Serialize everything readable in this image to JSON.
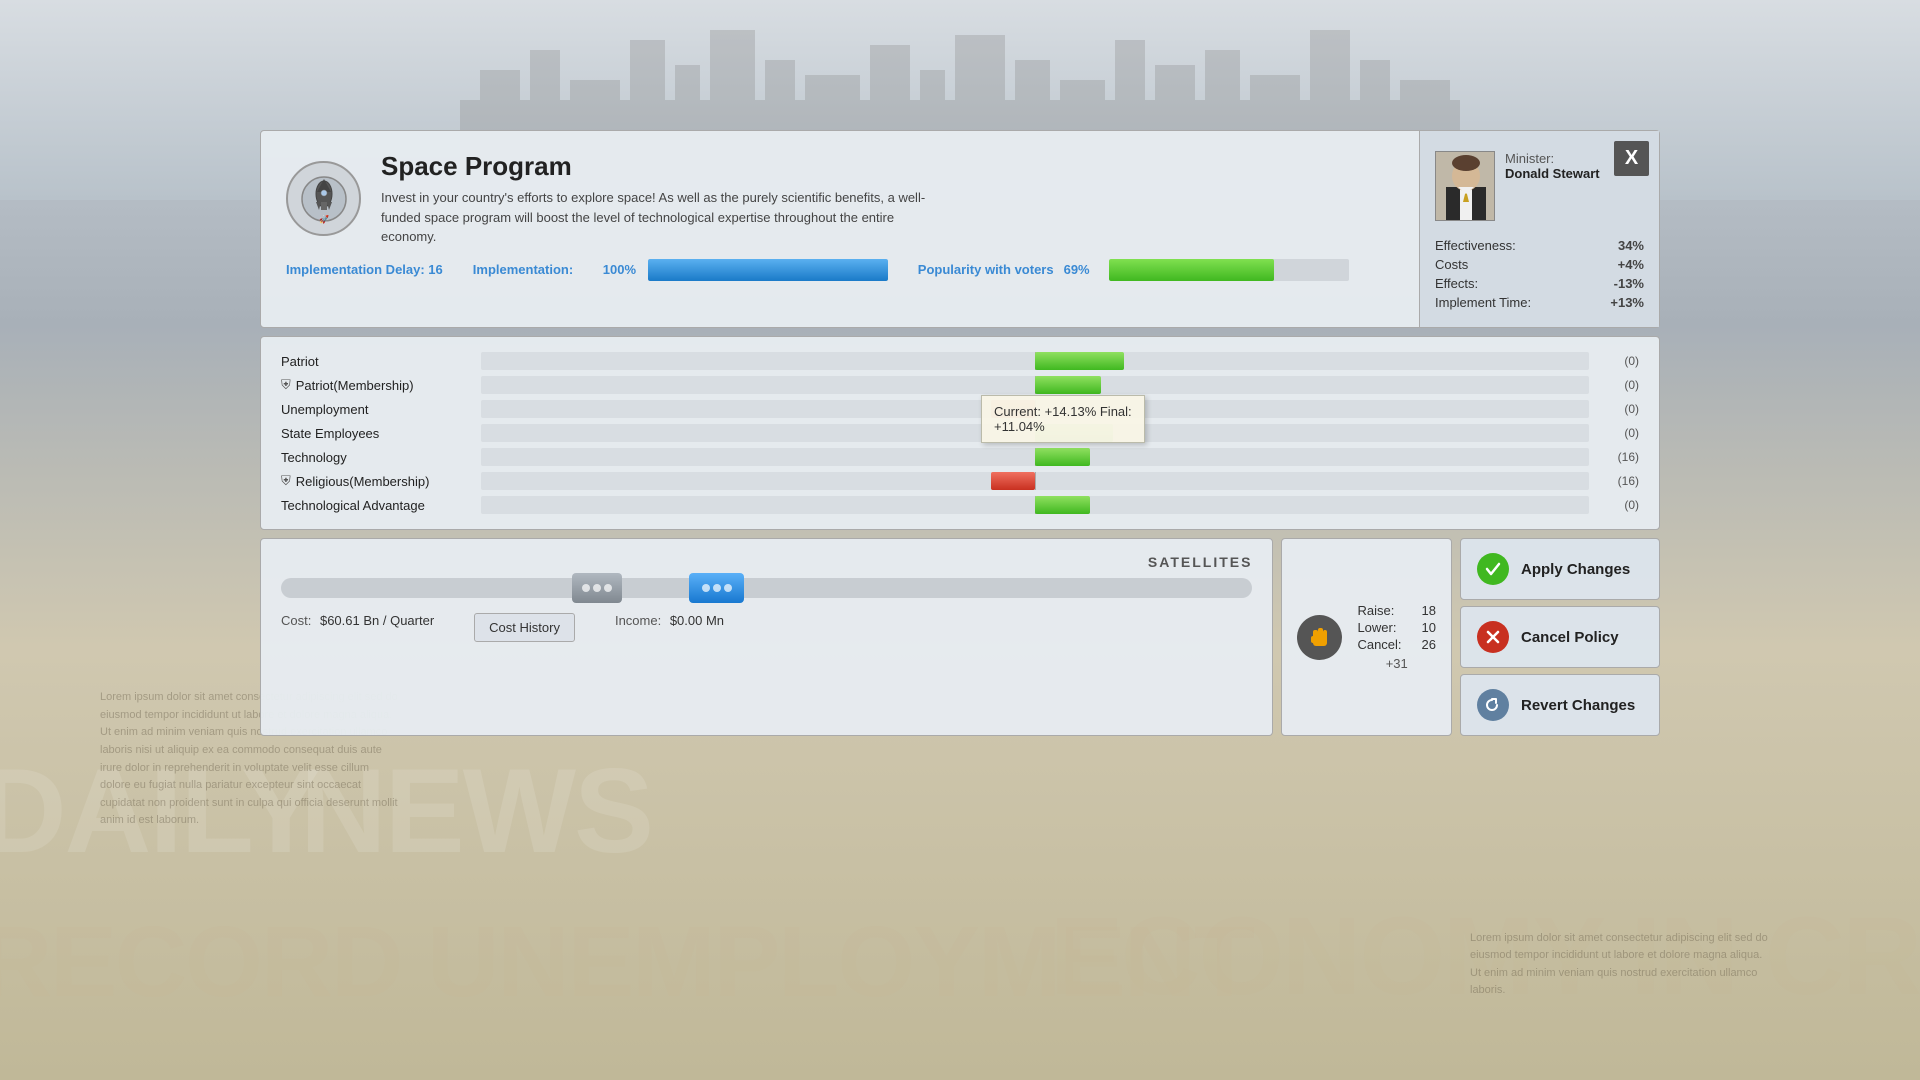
{
  "background": {
    "newspaper_lines": [
      "DAILY NEWS",
      "RECORD UNEMPLOYMENT",
      "ECONOMY IN CRIS"
    ]
  },
  "policy": {
    "title": "Space Program",
    "description": "Invest in your country's efforts to explore space! As well as the purely scientific benefits, a well-funded space program will boost the level of technological expertise throughout the entire economy.",
    "implementation_label": "Implementation Delay: 16",
    "impl_bar_label": "Implementation:",
    "impl_pct": "100%",
    "impl_bar_width": 100,
    "popularity_label": "Popularity with voters",
    "pop_pct": "69%",
    "pop_bar_width": 69
  },
  "minister": {
    "label": "Minister:",
    "name": "Donald Stewart",
    "effectiveness_label": "Effectiveness:",
    "effectiveness_val": "34%",
    "costs_label": "Costs",
    "costs_val": "+4%",
    "effects_label": "Effects:",
    "effects_val": "-13%",
    "implement_label": "Implement Time:",
    "implement_val": "+13%",
    "close_label": "X"
  },
  "effects": [
    {
      "name": "Patriot",
      "membership": false,
      "direction": "green",
      "width": 8,
      "value": "(0)"
    },
    {
      "name": "Patriot(Membership)",
      "membership": true,
      "direction": "green",
      "width": 6,
      "value": "(0)"
    },
    {
      "name": "Unemployment",
      "membership": false,
      "direction": "red",
      "width": 4,
      "value": "(0)",
      "has_tooltip": true
    },
    {
      "name": "State Employees",
      "membership": false,
      "direction": "green",
      "width": 7,
      "value": "(0)"
    },
    {
      "name": "Technology",
      "membership": false,
      "direction": "green",
      "width": 5,
      "value": "(16)"
    },
    {
      "name": "Religious(Membership)",
      "membership": true,
      "direction": "red",
      "width": 4,
      "value": "(16)"
    },
    {
      "name": "Technological Advantage",
      "membership": false,
      "direction": "green",
      "width": 5,
      "value": "(0)"
    }
  ],
  "tooltip": {
    "current": "Current: +14.13% Final:",
    "final": "+11.04%"
  },
  "slider": {
    "label": "SATELLITES",
    "cost_label": "Cost:",
    "cost_val": "$60.61 Bn / Quarter",
    "income_label": "Income:",
    "income_val": "$0.00 Mn"
  },
  "votes": {
    "raise_label": "Raise:",
    "raise_val": 18,
    "lower_label": "Lower:",
    "lower_val": 10,
    "cancel_label": "Cancel:",
    "cancel_val": 26,
    "net": "+31"
  },
  "buttons": {
    "cost_history": "Cost History",
    "apply": "Apply Changes",
    "cancel": "Cancel Policy",
    "revert": "Revert Changes"
  }
}
